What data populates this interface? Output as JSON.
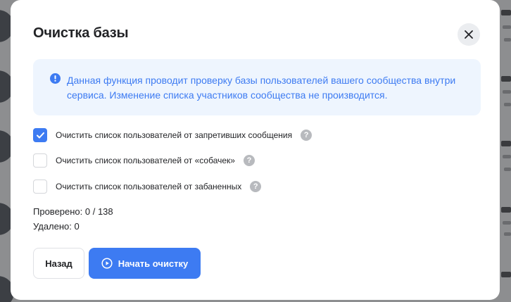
{
  "modal": {
    "title": "Очистка базы",
    "close_icon": "close-icon",
    "info": {
      "icon": "info-icon",
      "text": "Данная функция проводит проверку базы пользователей вашего сообщества внутри сервиса. Изменение списка участников сообщества не производится."
    },
    "options": [
      {
        "label": "Очистить список пользователей от запретивших сообщения",
        "checked": true,
        "help_icon": "question-icon"
      },
      {
        "label": "Очистить список пользователей от «собачек»",
        "checked": false,
        "help_icon": "question-icon"
      },
      {
        "label": "Очистить список пользователей от забаненных",
        "checked": false,
        "help_icon": "question-icon"
      }
    ],
    "stats": {
      "checked": "Проверено: 0 / 138",
      "deleted": "Удалено: 0"
    },
    "buttons": {
      "back": "Назад",
      "start": "Начать очистку",
      "start_icon": "play-circle-icon"
    }
  },
  "colors": {
    "accent": "#3d7bf2",
    "info_bg": "#eef5fe",
    "overlay": "#8d8e90"
  }
}
